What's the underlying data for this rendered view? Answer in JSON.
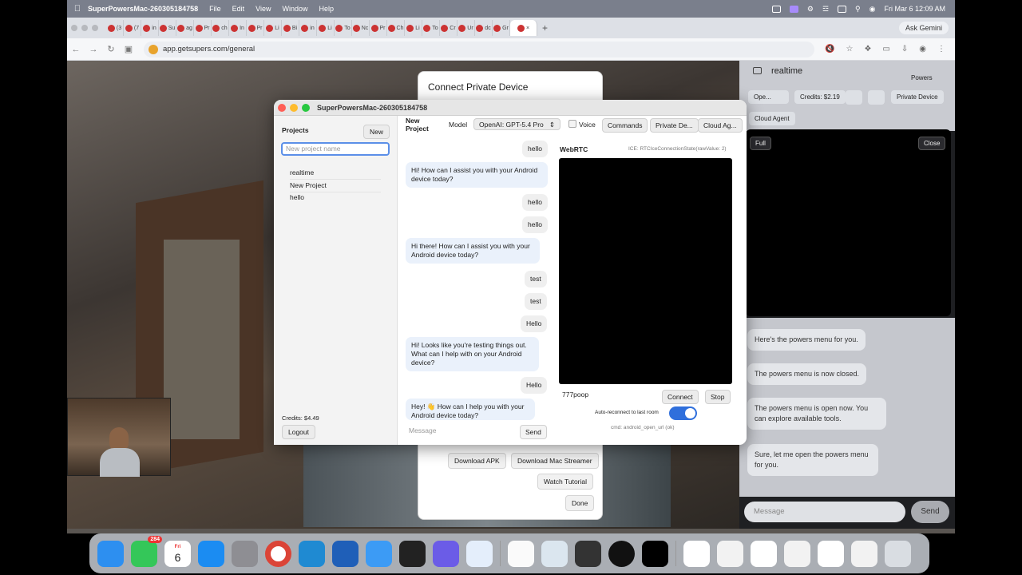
{
  "menubar": {
    "app_name": "SuperPowersMac-260305184758",
    "menus": [
      "File",
      "Edit",
      "View",
      "Window",
      "Help"
    ],
    "datetime": "Fri Mar 6  12:09 AM"
  },
  "browser": {
    "tabs": [
      "(3",
      "(7",
      "in",
      "Su",
      "ag",
      "Pr",
      "ch",
      "In",
      "Pr",
      "Li",
      "Bi",
      "in",
      "Li",
      "To",
      "Nc",
      "Pr",
      "Ch",
      "Li",
      "To",
      "Cr",
      "Ur",
      "dc",
      "Gr",
      ""
    ],
    "url": "app.getsupers.com/general",
    "ask_gemini": "Ask Gemini"
  },
  "bg_dialog": {
    "title": "Connect Private Device",
    "download_apk": "Download APK",
    "download_mac_streamer": "Download Mac Streamer",
    "watch_tutorial": "Watch Tutorial",
    "done": "Done"
  },
  "right_panel": {
    "title": "realtime",
    "powers": "Powers",
    "model": "Ope...",
    "credits": "Credits: $2.19",
    "private_device": "Private Device",
    "cloud_agent": "Cloud Agent",
    "full": "Full",
    "close": "Close",
    "messages": [
      "Here's the powers menu for you.",
      "The powers menu is now closed.",
      "The powers menu is open now. You can explore available tools.",
      "Sure, let me open the powers menu for you."
    ],
    "message_placeholder": "Message",
    "send": "Send"
  },
  "window": {
    "title": "SuperPowersMac-260305184758",
    "sidebar": {
      "projects_label": "Projects",
      "new_button": "New",
      "project_name_placeholder": "New project name",
      "projects": [
        "realtime",
        "New Project",
        "hello"
      ],
      "credits": "Credits: $4.49",
      "logout": "Logout"
    },
    "chat": {
      "project_title_line1": "New",
      "project_title_line2": "Project",
      "model_label": "Model",
      "model_value": "OpenAI: GPT-5.4 Pro",
      "voice_label": "Voice",
      "commands": "Commands",
      "private_device": "Private De...",
      "cloud_agent": "Cloud Ag...",
      "messages": [
        {
          "role": "user",
          "text": "hello"
        },
        {
          "role": "assistant",
          "text": "Hi! How can I assist you with your Android device today?"
        },
        {
          "role": "user",
          "text": "hello"
        },
        {
          "role": "user",
          "text": "hello"
        },
        {
          "role": "assistant",
          "text": "Hi there! How can I assist you with your Android device today?"
        },
        {
          "role": "user",
          "text": "test"
        },
        {
          "role": "user",
          "text": "test"
        },
        {
          "role": "user",
          "text": "Hello"
        },
        {
          "role": "assistant",
          "text": "Hi! Looks like you're testing things out. What can I help with on your Android device?"
        },
        {
          "role": "user",
          "text": "Hello"
        },
        {
          "role": "assistant",
          "text": "Hey! 👋 How can I help you with your Android device today?"
        }
      ],
      "message_placeholder": "Message",
      "send": "Send"
    },
    "webrtc": {
      "title": "WebRTC",
      "ice_state": "ICE: RTCIceConnectionState(rawValue: 2)",
      "room_value": "777poop",
      "connect": "Connect",
      "stop": "Stop",
      "auto_reconnect_label": "Auto-reconnect to last room",
      "auto_reconnect_on": true,
      "cmd_status": "cmd: android_open_url (ok)"
    }
  },
  "dock": {
    "messages_badge": "284",
    "calendar_day_label": "Fri",
    "calendar_day": "6"
  },
  "colors": {
    "accent": "#2f6fdc",
    "menubar": "#7a7f8c"
  }
}
